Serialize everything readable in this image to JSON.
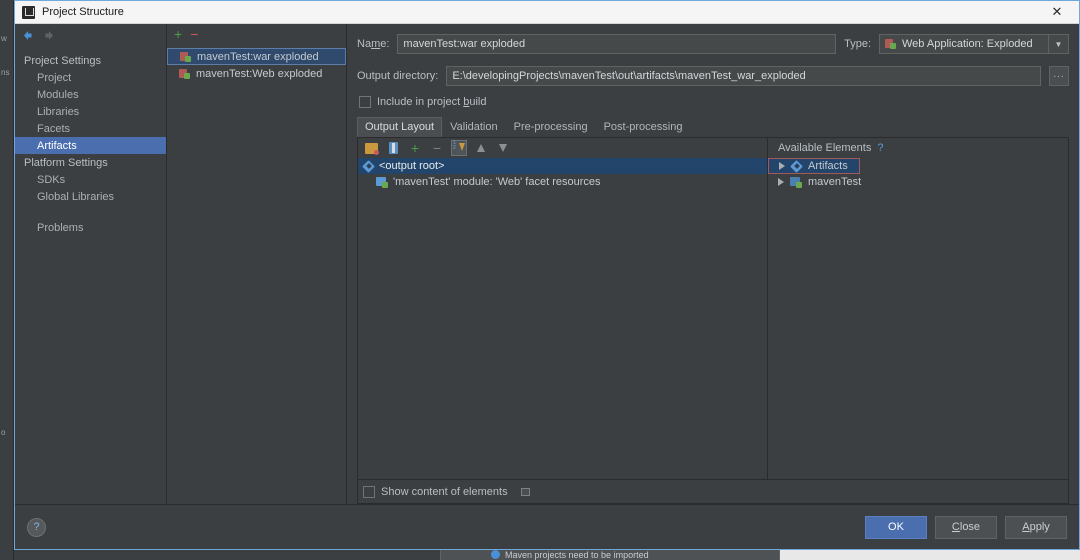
{
  "window": {
    "title": "Project Structure",
    "close_label": "✕",
    "close_icon": "close-icon",
    "app_icon": "intellij-idea-icon"
  },
  "background": {
    "vertical_labels": [
      "w",
      "ns",
      "o"
    ]
  },
  "notification": {
    "text": "Maven projects need to be imported",
    "icon": "maven-icon"
  },
  "sidebar": {
    "nav": {
      "back_icon": "arrow-left-icon",
      "forward_icon": "arrow-right-icon"
    },
    "items": [
      {
        "label": "Project Settings",
        "type": "group",
        "selected": false
      },
      {
        "label": "Project",
        "type": "child",
        "selected": false
      },
      {
        "label": "Modules",
        "type": "child",
        "selected": false
      },
      {
        "label": "Libraries",
        "type": "child",
        "selected": false
      },
      {
        "label": "Facets",
        "type": "child",
        "selected": false
      },
      {
        "label": "Artifacts",
        "type": "child",
        "selected": true
      },
      {
        "label": "Platform Settings",
        "type": "group",
        "selected": false
      },
      {
        "label": "SDKs",
        "type": "child",
        "selected": false
      },
      {
        "label": "Global Libraries",
        "type": "child",
        "selected": false
      }
    ],
    "problems_label": "Problems"
  },
  "artifacts_panel": {
    "add_label": "+",
    "remove_label": "−",
    "items": [
      {
        "label": "mavenTest:war exploded",
        "selected": true
      },
      {
        "label": "mavenTest:Web exploded",
        "selected": false
      }
    ]
  },
  "details": {
    "name_label": "Name:",
    "name_value": "mavenTest:war exploded",
    "type_label": "Type:",
    "type_value": "Web Application: Exploded",
    "type_arrow": "▼",
    "outdir_label": "Output directory:",
    "outdir_value": "E:\\developingProjects\\mavenTest\\out\\artifacts\\mavenTest_war_exploded",
    "browse_label": "...",
    "include_label": "Include in project build",
    "include_checked": false,
    "tabs": [
      {
        "label": "Output Layout",
        "active": true
      },
      {
        "label": "Validation",
        "active": false
      },
      {
        "label": "Pre-processing",
        "active": false
      },
      {
        "label": "Post-processing",
        "active": false
      }
    ]
  },
  "tree_toolbar": {
    "buttons": [
      {
        "name": "add-directory-icon",
        "pressed": false
      },
      {
        "name": "add-archive-icon",
        "pressed": false
      },
      {
        "name": "add-copy-icon",
        "pressed": false
      },
      {
        "name": "remove-icon",
        "pressed": false
      },
      {
        "name": "sort-icon",
        "pressed": true
      },
      {
        "name": "move-up-icon",
        "pressed": false
      },
      {
        "name": "move-down-icon",
        "pressed": false
      }
    ]
  },
  "output_tree": {
    "rows": [
      {
        "label": "<output root>",
        "icon": "output-root-icon",
        "selected": true,
        "indent": false
      },
      {
        "label": "'mavenTest' module: 'Web' facet resources",
        "icon": "module-facet-icon",
        "selected": false,
        "indent": true
      }
    ]
  },
  "available_elements": {
    "header": "Available Elements",
    "help_label": "?",
    "rows": [
      {
        "label": "Artifacts",
        "icon": "artifacts-node-icon",
        "highlighted": true
      },
      {
        "label": "mavenTest",
        "icon": "module-node-icon",
        "highlighted": false
      }
    ]
  },
  "editor_footer": {
    "show_content_label": "Show content of elements",
    "show_content_checked": false
  },
  "footer": {
    "help_label": "?",
    "buttons": [
      {
        "label": "OK",
        "primary": true
      },
      {
        "label": "Close",
        "primary": false
      },
      {
        "label": "Apply",
        "primary": false
      }
    ]
  },
  "colors": {
    "dialog_bg": "#3c3f41",
    "accent_blue": "#4b6eaf",
    "selection_blue": "#23456b",
    "highlight_red": "#a05a5a",
    "titlebar_bg": "#f5f5f5"
  }
}
